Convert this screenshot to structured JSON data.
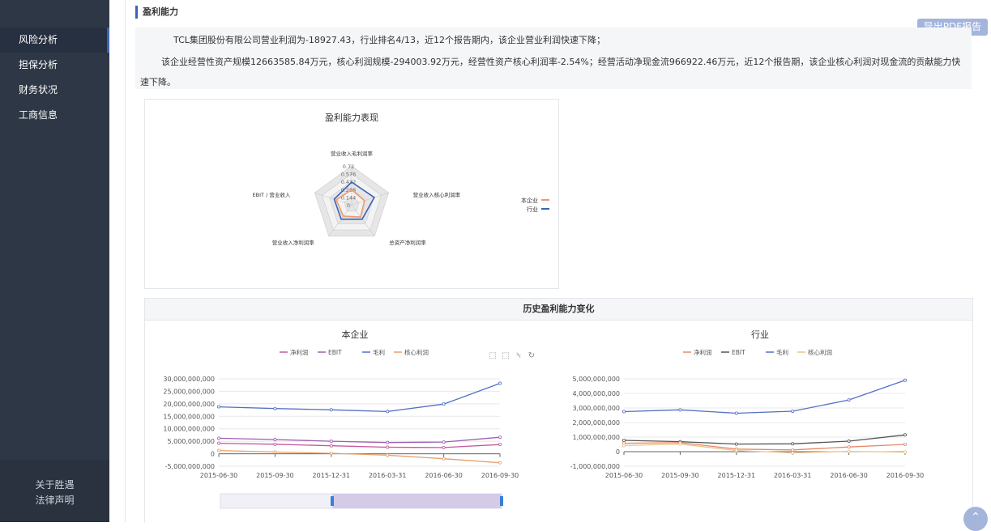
{
  "sidebar": {
    "items": [
      {
        "label": "风险分析",
        "active": true
      },
      {
        "label": "担保分析",
        "active": false
      },
      {
        "label": "财务状况",
        "active": false
      },
      {
        "label": "工商信息",
        "active": false
      }
    ],
    "footer": {
      "about": "关于胜遇",
      "legal": "法律声明"
    }
  },
  "section": {
    "title": "盈利能力"
  },
  "toolbar": {
    "export_label": "导出PDF报告"
  },
  "summary": {
    "line1": "TCL集团股份有限公司营业利润为-18927.43，行业排名4/13，近12个报告期内，该企业营业利润快速下降；",
    "line2": "该企业经营性资产规模12663585.84万元，核心利润规模-294003.92万元，经营性资产核心利润率-2.54%；经营活动净现金流966922.46万元，近12个报告期，该企业核心利润对现金流的贡献能力快",
    "line3": "速下降。"
  },
  "history": {
    "title": "历史盈利能力变化"
  },
  "colors": {
    "accent": "#3b63b7",
    "sidebar": "#2e3745"
  },
  "chart_data": [
    {
      "type": "radar",
      "title": "盈利能力表现",
      "indicators": [
        "营业收入毛利润率",
        "营业收入核心利润率",
        "总资产净利润率",
        "营业收入净利润率",
        "EBIT / 营业收入"
      ],
      "ticks": [
        "0.72",
        "0.576",
        "0.432",
        "0.288",
        "0.144",
        "0"
      ],
      "max": 0.72,
      "legend": [
        "本企业",
        "行业"
      ],
      "legend_position": "right",
      "series": [
        {
          "name": "本企业",
          "color": "#ee9a6c",
          "values": [
            0.28,
            0.25,
            0.28,
            0.26,
            0.3
          ]
        },
        {
          "name": "行业",
          "color": "#3b63b7",
          "values": [
            0.42,
            0.44,
            0.33,
            0.33,
            0.34
          ]
        }
      ]
    },
    {
      "type": "line",
      "title": "本企业",
      "legend": [
        "净利润",
        "EBIT",
        "毛利",
        "核心利润"
      ],
      "x": [
        "2015-06-30",
        "2015-09-30",
        "2015-12-31",
        "2016-03-31",
        "2016-06-30",
        "2016-09-30"
      ],
      "yticks": [
        "30,000,000,000",
        "25,000,000,000",
        "20,000,000,000",
        "15,000,000,000",
        "10,000,000,000",
        "5,000,000,000",
        "0",
        "-5,000,000,000"
      ],
      "ylim": [
        -5000000000,
        30000000000
      ],
      "series": [
        {
          "name": "毛利",
          "color": "#5470c6",
          "values": [
            18800000000,
            18100000000,
            17600000000,
            16900000000,
            19900000000,
            28200000000
          ]
        },
        {
          "name": "EBIT",
          "color": "#9a60b4",
          "values": [
            6200000000,
            5700000000,
            5000000000,
            4500000000,
            4700000000,
            6600000000
          ]
        },
        {
          "name": "净利润",
          "color": "#c45a9a",
          "values": [
            4200000000,
            3800000000,
            3200000000,
            2600000000,
            2500000000,
            3700000000
          ]
        },
        {
          "name": "核心利润",
          "color": "#e6a06b",
          "values": [
            1300000000,
            700000000,
            200000000,
            -600000000,
            -2000000000,
            -3600000000
          ]
        }
      ]
    },
    {
      "type": "line",
      "title": "行业",
      "legend": [
        "净利润",
        "EBIT",
        "毛利",
        "核心利润"
      ],
      "x": [
        "2015-06-30",
        "2015-09-30",
        "2015-12-31",
        "2016-03-31",
        "2016-06-30",
        "2016-09-30"
      ],
      "yticks": [
        "5,000,000,000",
        "4,000,000,000",
        "3,000,000,000",
        "2,000,000,000",
        "1,000,000,000",
        "0",
        "-1,000,000,000"
      ],
      "ylim": [
        -1000000000,
        5000000000
      ],
      "series": [
        {
          "name": "毛利",
          "color": "#5470c6",
          "values": [
            2750000000,
            2870000000,
            2640000000,
            2780000000,
            3550000000,
            4900000000
          ]
        },
        {
          "name": "EBIT",
          "color": "#555555",
          "values": [
            780000000,
            690000000,
            520000000,
            540000000,
            720000000,
            1150000000
          ]
        },
        {
          "name": "净利润",
          "color": "#e8896a",
          "values": [
            580000000,
            620000000,
            180000000,
            120000000,
            320000000,
            500000000
          ]
        },
        {
          "name": "核心利润",
          "color": "#e8c48a",
          "values": [
            420000000,
            520000000,
            80000000,
            -80000000,
            20000000,
            -30000000
          ]
        }
      ]
    }
  ]
}
